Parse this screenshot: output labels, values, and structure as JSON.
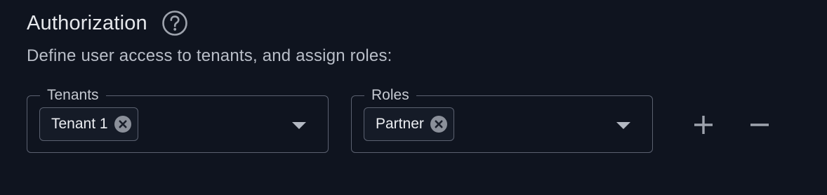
{
  "header": {
    "title": "Authorization",
    "help_icon": "question-circle-icon"
  },
  "description": "Define user access to tenants, and assign roles:",
  "tenants_field": {
    "label": "Tenants",
    "selected": [
      {
        "label": "Tenant 1"
      }
    ],
    "chip_remove_icon": "close-circle-icon",
    "dropdown_icon": "caret-down-icon"
  },
  "roles_field": {
    "label": "Roles",
    "selected": [
      {
        "label": "Partner"
      }
    ],
    "chip_remove_icon": "close-circle-icon",
    "dropdown_icon": "caret-down-icon"
  },
  "actions": {
    "add_icon": "plus-icon",
    "remove_icon": "minus-icon"
  },
  "colors": {
    "background": "#0f141f",
    "border": "#5b6170",
    "text_primary": "#e6e8ec",
    "text_secondary": "#b9bec8",
    "icon": "#9ea3ad"
  }
}
